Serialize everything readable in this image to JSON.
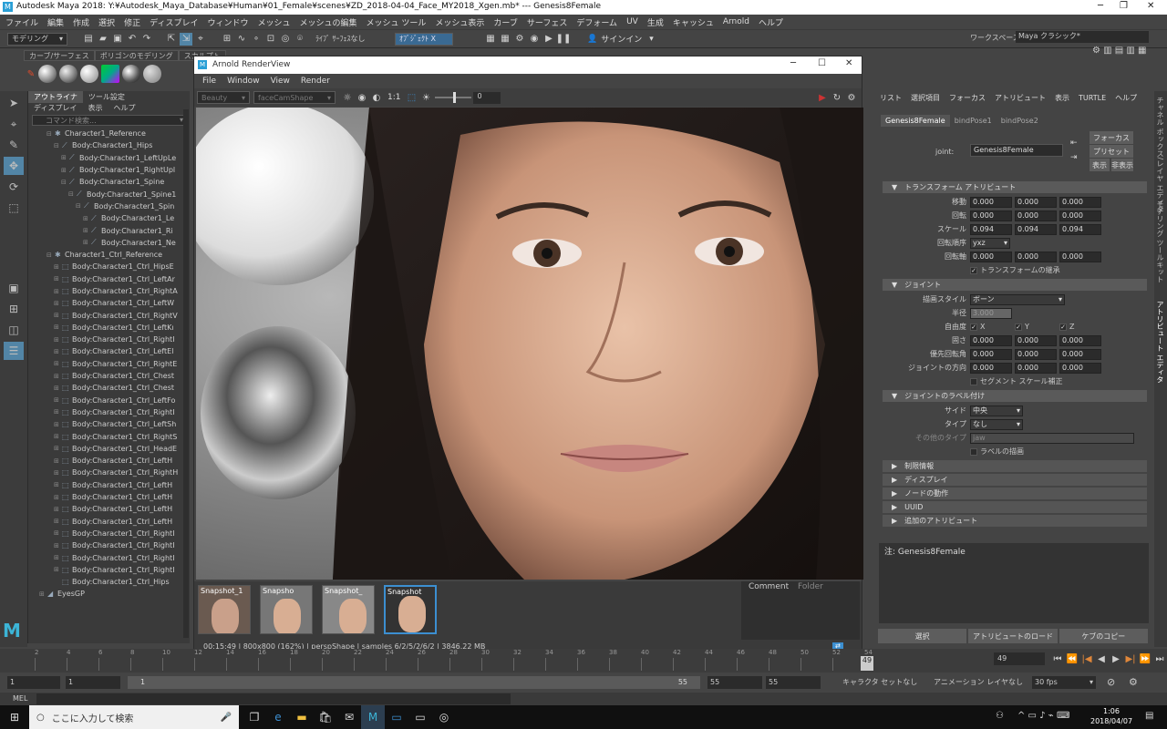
{
  "app": {
    "title": "Autodesk Maya 2018: Y:¥Autodesk_Maya_Database¥Human¥01_Female¥scenes¥ZD_2018-04-04_Face_MY2018_Xgen.mb*  ---  Genesis8Female",
    "menus": [
      "ファイル",
      "編集",
      "作成",
      "選択",
      "修正",
      "ディスプレイ",
      "ウィンドウ",
      "メッシュ",
      "メッシュの編集",
      "メッシュ ツール",
      "メッシュ表示",
      "カーブ",
      "サーフェス",
      "デフォーム",
      "UV",
      "生成",
      "キャッシュ",
      "Arnold",
      "ヘルプ"
    ],
    "workspace_label": "ワークスペース:",
    "workspace_value": "Maya クラシック*",
    "accent": "#3c8fd1"
  },
  "statusline": {
    "mode": "モデリング",
    "live_surface": "ﾗｲﾌﾞ ｻｰﾌｪｽなし",
    "object_mode": "ｵﾌﾞｼﾞｪｸﾄ X",
    "signin": "サインイン"
  },
  "shelf": {
    "tabs": [
      "カーブ/サーフェス",
      "ポリゴンのモデリング",
      "スカルプト"
    ]
  },
  "outliner": {
    "tabs": [
      "アウトライナ",
      "ツール設定"
    ],
    "menu": [
      "ディスプレイ",
      "表示",
      "ヘルプ"
    ],
    "search_placeholder": "コマンド検索...",
    "rows": [
      {
        "ex": "⊟",
        "ic": "✱",
        "label": "Character1_Reference",
        "indent": 1
      },
      {
        "ex": "⊟",
        "ic": "⟋",
        "label": "Body:Character1_Hips",
        "indent": 2
      },
      {
        "ex": "⊞",
        "ic": "⟋",
        "label": "Body:Character1_LeftUpLe",
        "indent": 3
      },
      {
        "ex": "⊞",
        "ic": "⟋",
        "label": "Body:Character1_RightUpl",
        "indent": 3
      },
      {
        "ex": "⊟",
        "ic": "⟋",
        "label": "Body:Character1_Spine",
        "indent": 3
      },
      {
        "ex": "⊟",
        "ic": "⟋",
        "label": "Body:Character1_Spine1",
        "indent": 4
      },
      {
        "ex": "⊟",
        "ic": "⟋",
        "label": "Body:Character1_Spin",
        "indent": 5
      },
      {
        "ex": "⊞",
        "ic": "⟋",
        "label": "Body:Character1_Le",
        "indent": 6
      },
      {
        "ex": "⊞",
        "ic": "⟋",
        "label": "Body:Character1_Ri",
        "indent": 6
      },
      {
        "ex": "⊞",
        "ic": "⟋",
        "label": "Body:Character1_Ne",
        "indent": 6
      },
      {
        "ex": "⊟",
        "ic": "✱",
        "label": "Character1_Ctrl_Reference",
        "indent": 1
      },
      {
        "ex": "⊞",
        "ic": "⬚",
        "label": "Body:Character1_Ctrl_HipsE",
        "indent": 2
      },
      {
        "ex": "⊞",
        "ic": "⬚",
        "label": "Body:Character1_Ctrl_LeftAr",
        "indent": 2
      },
      {
        "ex": "⊞",
        "ic": "⬚",
        "label": "Body:Character1_Ctrl_RightA",
        "indent": 2
      },
      {
        "ex": "⊞",
        "ic": "⬚",
        "label": "Body:Character1_Ctrl_LeftW",
        "indent": 2
      },
      {
        "ex": "⊞",
        "ic": "⬚",
        "label": "Body:Character1_Ctrl_RightV",
        "indent": 2
      },
      {
        "ex": "⊞",
        "ic": "⬚",
        "label": "Body:Character1_Ctrl_LeftKı",
        "indent": 2
      },
      {
        "ex": "⊞",
        "ic": "⬚",
        "label": "Body:Character1_Ctrl_RightI",
        "indent": 2
      },
      {
        "ex": "⊞",
        "ic": "⬚",
        "label": "Body:Character1_Ctrl_LeftEl",
        "indent": 2
      },
      {
        "ex": "⊞",
        "ic": "⬚",
        "label": "Body:Character1_Ctrl_RightE",
        "indent": 2
      },
      {
        "ex": "⊞",
        "ic": "⬚",
        "label": "Body:Character1_Ctrl_Chest",
        "indent": 2
      },
      {
        "ex": "⊞",
        "ic": "⬚",
        "label": "Body:Character1_Ctrl_Chest",
        "indent": 2
      },
      {
        "ex": "⊞",
        "ic": "⬚",
        "label": "Body:Character1_Ctrl_LeftFo",
        "indent": 2
      },
      {
        "ex": "⊞",
        "ic": "⬚",
        "label": "Body:Character1_Ctrl_RightI",
        "indent": 2
      },
      {
        "ex": "⊞",
        "ic": "⬚",
        "label": "Body:Character1_Ctrl_LeftSh",
        "indent": 2
      },
      {
        "ex": "⊞",
        "ic": "⬚",
        "label": "Body:Character1_Ctrl_RightS",
        "indent": 2
      },
      {
        "ex": "⊞",
        "ic": "⬚",
        "label": "Body:Character1_Ctrl_HeadE",
        "indent": 2
      },
      {
        "ex": "⊞",
        "ic": "⬚",
        "label": "Body:Character1_Ctrl_LeftH",
        "indent": 2
      },
      {
        "ex": "⊞",
        "ic": "⬚",
        "label": "Body:Character1_Ctrl_RightH",
        "indent": 2
      },
      {
        "ex": "⊞",
        "ic": "⬚",
        "label": "Body:Character1_Ctrl_LeftH",
        "indent": 2
      },
      {
        "ex": "⊞",
        "ic": "⬚",
        "label": "Body:Character1_Ctrl_LeftH",
        "indent": 2
      },
      {
        "ex": "⊞",
        "ic": "⬚",
        "label": "Body:Character1_Ctrl_LeftH",
        "indent": 2
      },
      {
        "ex": "⊞",
        "ic": "⬚",
        "label": "Body:Character1_Ctrl_LeftH",
        "indent": 2
      },
      {
        "ex": "⊞",
        "ic": "⬚",
        "label": "Body:Character1_Ctrl_RightI",
        "indent": 2
      },
      {
        "ex": "⊞",
        "ic": "⬚",
        "label": "Body:Character1_Ctrl_RightI",
        "indent": 2
      },
      {
        "ex": "⊞",
        "ic": "⬚",
        "label": "Body:Character1_Ctrl_RightI",
        "indent": 2
      },
      {
        "ex": "⊞",
        "ic": "⬚",
        "label": "Body:Character1_Ctrl_RightI",
        "indent": 2
      },
      {
        "ex": "",
        "ic": "⬚",
        "label": "Body:Character1_Ctrl_Hips",
        "indent": 2
      },
      {
        "ex": "⊞",
        "ic": "◢",
        "label": "EyesGP",
        "indent": 0
      }
    ]
  },
  "renderview": {
    "title": "Arnold RenderView",
    "menus": [
      "File",
      "Window",
      "View",
      "Render"
    ],
    "aov": "Beauty",
    "camera": "faceCamShape",
    "ratio": "1:1",
    "exposure": "0",
    "snapshots": [
      "Snapshot_1",
      "Snapsho",
      "Snapshot_",
      "Snapshot"
    ],
    "comment_tabs": [
      "Comment",
      "Folder"
    ],
    "status": "00:15:49 | 800x800 (162%) | perspShape | samples 6/2/5/2/6/2 | 3846.22 MB"
  },
  "attr_editor": {
    "menu": [
      "リスト",
      "選択項目",
      "フォーカス",
      "アトリビュート",
      "表示",
      "TURTLE",
      "ヘルプ"
    ],
    "tabs": [
      "Genesis8Female",
      "bindPose1",
      "bindPose2"
    ],
    "joint_label": "joint:",
    "joint_value": "Genesis8Female",
    "focus_btn": "フォーカス",
    "preset_btn": "プリセット",
    "show_btn": "表示",
    "hide_btn": "非表示",
    "transform_header": "トランスフォーム アトリビュート",
    "transform_rows": [
      {
        "label": "移動",
        "v": [
          "0.000",
          "0.000",
          "0.000"
        ]
      },
      {
        "label": "回転",
        "v": [
          "0.000",
          "0.000",
          "0.000"
        ]
      },
      {
        "label": "スケール",
        "v": [
          "0.094",
          "0.094",
          "0.094"
        ]
      }
    ],
    "rot_order_label": "回転順序",
    "rot_order": "yxz",
    "rot_axis_label": "回転軸",
    "rot_axis": [
      "0.000",
      "0.000",
      "0.000"
    ],
    "inherit": "トランスフォームの継承",
    "joint_header": "ジョイント",
    "draw_style_label": "描画スタイル",
    "draw_style": "ボーン",
    "radius_label": "半径",
    "radius": "3.000",
    "dof_label": "自由度",
    "dof": [
      "X",
      "Y",
      "Z"
    ],
    "joint_rows": [
      {
        "label": "固さ",
        "v": [
          "0.000",
          "0.000",
          "0.000"
        ]
      },
      {
        "label": "優先回転角",
        "v": [
          "0.000",
          "0.000",
          "0.000"
        ]
      },
      {
        "label": "ジョイントの方向",
        "v": [
          "0.000",
          "0.000",
          "0.000"
        ]
      }
    ],
    "segment_scale": "セグメント スケール補正",
    "label_header": "ジョイントのラベル付け",
    "side_label": "サイド",
    "side": "中央",
    "type_label": "タイプ",
    "type": "なし",
    "other_type_label": "その他のタイプ",
    "other_type": "jaw",
    "draw_label": "ラベルの描画",
    "collapsed": [
      "制限情報",
      "ディスプレイ",
      "ノードの動作",
      "UUID",
      "追加のアトリビュート"
    ],
    "notes_label": "注: Genesis8Female",
    "bottom_buttons": [
      "選択",
      "アトリビュートのロード",
      "ケブのコピー"
    ],
    "side_tabs": [
      "チャネル ボックス/レイヤ エディタ",
      "モデリング ツールキット",
      "アトリビュート エディタ"
    ]
  },
  "timeline": {
    "ticks": [
      "2",
      "4",
      "6",
      "8",
      "10",
      "12",
      "14",
      "16",
      "18",
      "20",
      "22",
      "24",
      "26",
      "28",
      "30",
      "32",
      "34",
      "36",
      "38",
      "40",
      "42",
      "44",
      "46",
      "48",
      "50",
      "52",
      "54"
    ],
    "current": "49",
    "current_field": "49"
  },
  "range": {
    "start": "1",
    "start2": "1",
    "slider_start": "1",
    "slider_end": "55",
    "end": "55",
    "end2": "55",
    "char_set": "キャラクタ セットなし",
    "anim_layer": "アニメーション レイヤなし",
    "fps": "30 fps"
  },
  "cmdline": {
    "label": "MEL"
  },
  "taskbar": {
    "search": "ここに入力して検索",
    "time": "1:06",
    "date": "2018/04/07"
  }
}
